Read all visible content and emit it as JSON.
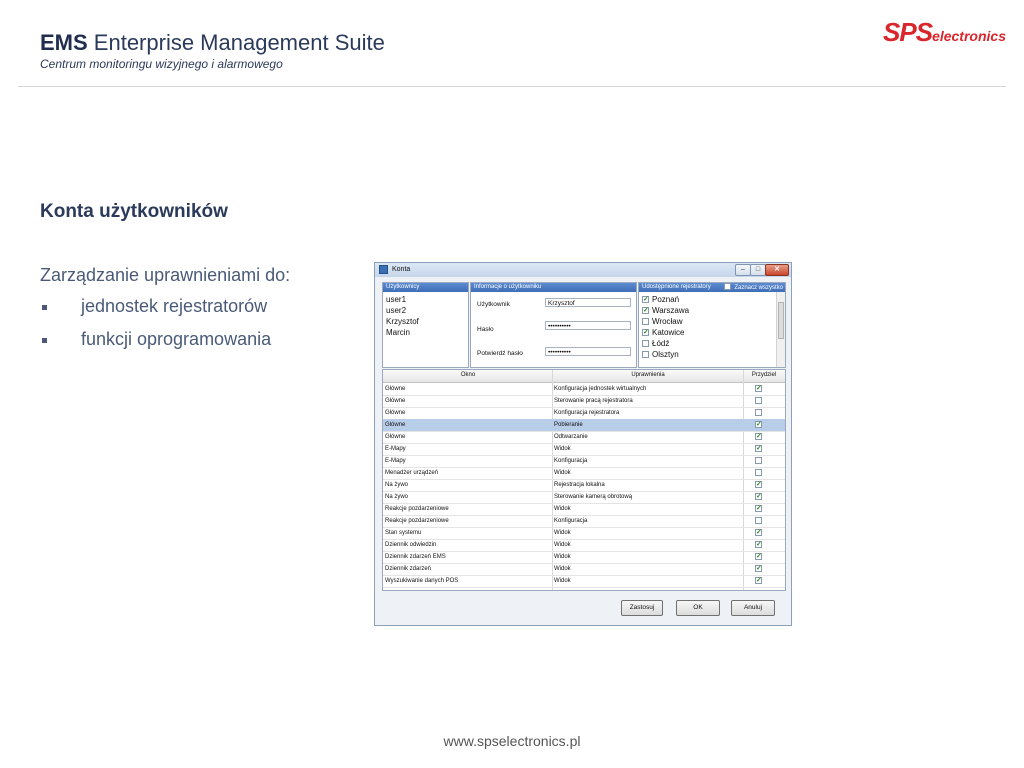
{
  "header": {
    "title_bold": "EMS",
    "title_rest": " Enterprise Management Suite",
    "subtitle": "Centrum monitoringu wizyjnego i alarmowego",
    "logo_sps": "SPS",
    "logo_electronics": "electronics"
  },
  "section": {
    "title": "Konta użytkowników",
    "intro": "Zarządzanie uprawnieniami do:",
    "bullets": [
      "jednostek rejestratorów",
      "funkcji oprogramowania"
    ]
  },
  "footer": {
    "url": "www.spselectronics.pl"
  },
  "dialog": {
    "title": "Konta",
    "users_header": "Użytkownicy",
    "users": [
      "user1",
      "user2",
      "Krzysztof",
      "Marcin"
    ],
    "info_header": "Informacje o użytkowniku",
    "user_label": "Użytkownik",
    "user_value": "Krzysztof",
    "password_label": "Hasło",
    "password_value": "••••••••••",
    "confirm_label": "Potwierdź hasło",
    "confirm_value": "••••••••••",
    "registers_header": "Udostępnione rejestratory",
    "select_all": "Zaznacz wszystko",
    "registers": [
      {
        "name": "Poznań",
        "checked": true
      },
      {
        "name": "Warszawa",
        "checked": true
      },
      {
        "name": "Wrocław",
        "checked": false
      },
      {
        "name": "Katowice",
        "checked": true
      },
      {
        "name": "Łódź",
        "checked": false
      },
      {
        "name": "Olsztyn",
        "checked": false
      }
    ],
    "table_headers": [
      "Okno",
      "Uprawnienia",
      "Przydziel"
    ],
    "rows": [
      {
        "window": "Główne",
        "permission": "Konfiguracja jednostek wirtualnych",
        "granted": true,
        "selected": false
      },
      {
        "window": "Główne",
        "permission": "Sterowanie pracą rejestratora",
        "granted": false,
        "selected": false
      },
      {
        "window": "Główne",
        "permission": "Konfiguracja rejestratora",
        "granted": false,
        "selected": false
      },
      {
        "window": "Główne",
        "permission": "Pobieranie",
        "granted": true,
        "selected": true
      },
      {
        "window": "Główne",
        "permission": "Odtwarzanie",
        "granted": true,
        "selected": false
      },
      {
        "window": "E-Mapy",
        "permission": "Widok",
        "granted": true,
        "selected": false
      },
      {
        "window": "E-Mapy",
        "permission": "Konfiguracja",
        "granted": false,
        "selected": false
      },
      {
        "window": "Menadżer urządzeń",
        "permission": "Widok",
        "granted": false,
        "selected": false
      },
      {
        "window": "Na żywo",
        "permission": "Rejestracja lokalna",
        "granted": true,
        "selected": false
      },
      {
        "window": "Na żywo",
        "permission": "Sterowanie kamerą obrotową",
        "granted": true,
        "selected": false
      },
      {
        "window": "Reakcje pozdarzeniowe",
        "permission": "Widok",
        "granted": true,
        "selected": false
      },
      {
        "window": "Reakcje pozdarzeniowe",
        "permission": "Konfiguracja",
        "granted": false,
        "selected": false
      },
      {
        "window": "Stan systemu",
        "permission": "Widok",
        "granted": true,
        "selected": false
      },
      {
        "window": "Dziennik odwiedzin",
        "permission": "Widok",
        "granted": true,
        "selected": false
      },
      {
        "window": "Dziennik zdarzeń EMS",
        "permission": "Widok",
        "granted": true,
        "selected": false
      },
      {
        "window": "Dziennik zdarzeń",
        "permission": "Widok",
        "granted": true,
        "selected": false
      },
      {
        "window": "Wyszukiwanie danych POS",
        "permission": "Widok",
        "granted": true,
        "selected": false
      }
    ],
    "buttons": {
      "apply": "Zastosuj",
      "ok": "OK",
      "cancel": "Anuluj"
    }
  }
}
